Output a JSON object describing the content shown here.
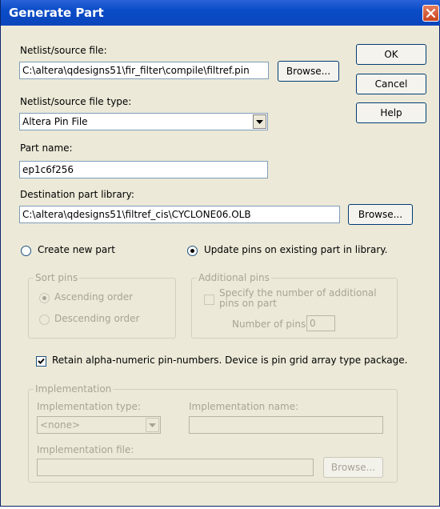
{
  "window": {
    "title": "Generate Part"
  },
  "netlist": {
    "label": "Netlist/source file:",
    "value": "C:\\altera\\qdesigns51\\fir_filter\\compile\\filtref.pin",
    "browse": "Browse..."
  },
  "filetype": {
    "label": "Netlist/source file type:",
    "value": "Altera Pin File"
  },
  "partname": {
    "label": "Part name:",
    "value": "ep1c6f256"
  },
  "destlib": {
    "label": "Destination part library:",
    "value": "C:\\altera\\qdesigns51\\filtref_cis\\CYCLONE06.OLB",
    "browse": "Browse..."
  },
  "buttons": {
    "ok": "OK",
    "cancel": "Cancel",
    "help": "Help"
  },
  "mode": {
    "create": "Create new part",
    "update": "Update pins on existing part in library.",
    "selected": "update"
  },
  "sortpins": {
    "title": "Sort pins",
    "ascending": "Ascending order",
    "descending": "Descending order"
  },
  "additional": {
    "title": "Additional pins",
    "specify": "Specify the number of additional pins on part",
    "numlabel": "Number of pins:",
    "numvalue": "0"
  },
  "retain": {
    "label": "Retain alpha-numeric pin-numbers. Device is pin grid array type package.",
    "checked": true
  },
  "implementation": {
    "title": "Implementation",
    "type_label": "Implementation type:",
    "type_value": "<none>",
    "name_label": "Implementation name:",
    "name_value": "",
    "file_label": "Implementation file:",
    "file_value": "",
    "browse": "Browse..."
  },
  "colors": {
    "titlebar": "#0a4cc8",
    "dialog": "#ece9d8",
    "close": "#c9431d"
  }
}
